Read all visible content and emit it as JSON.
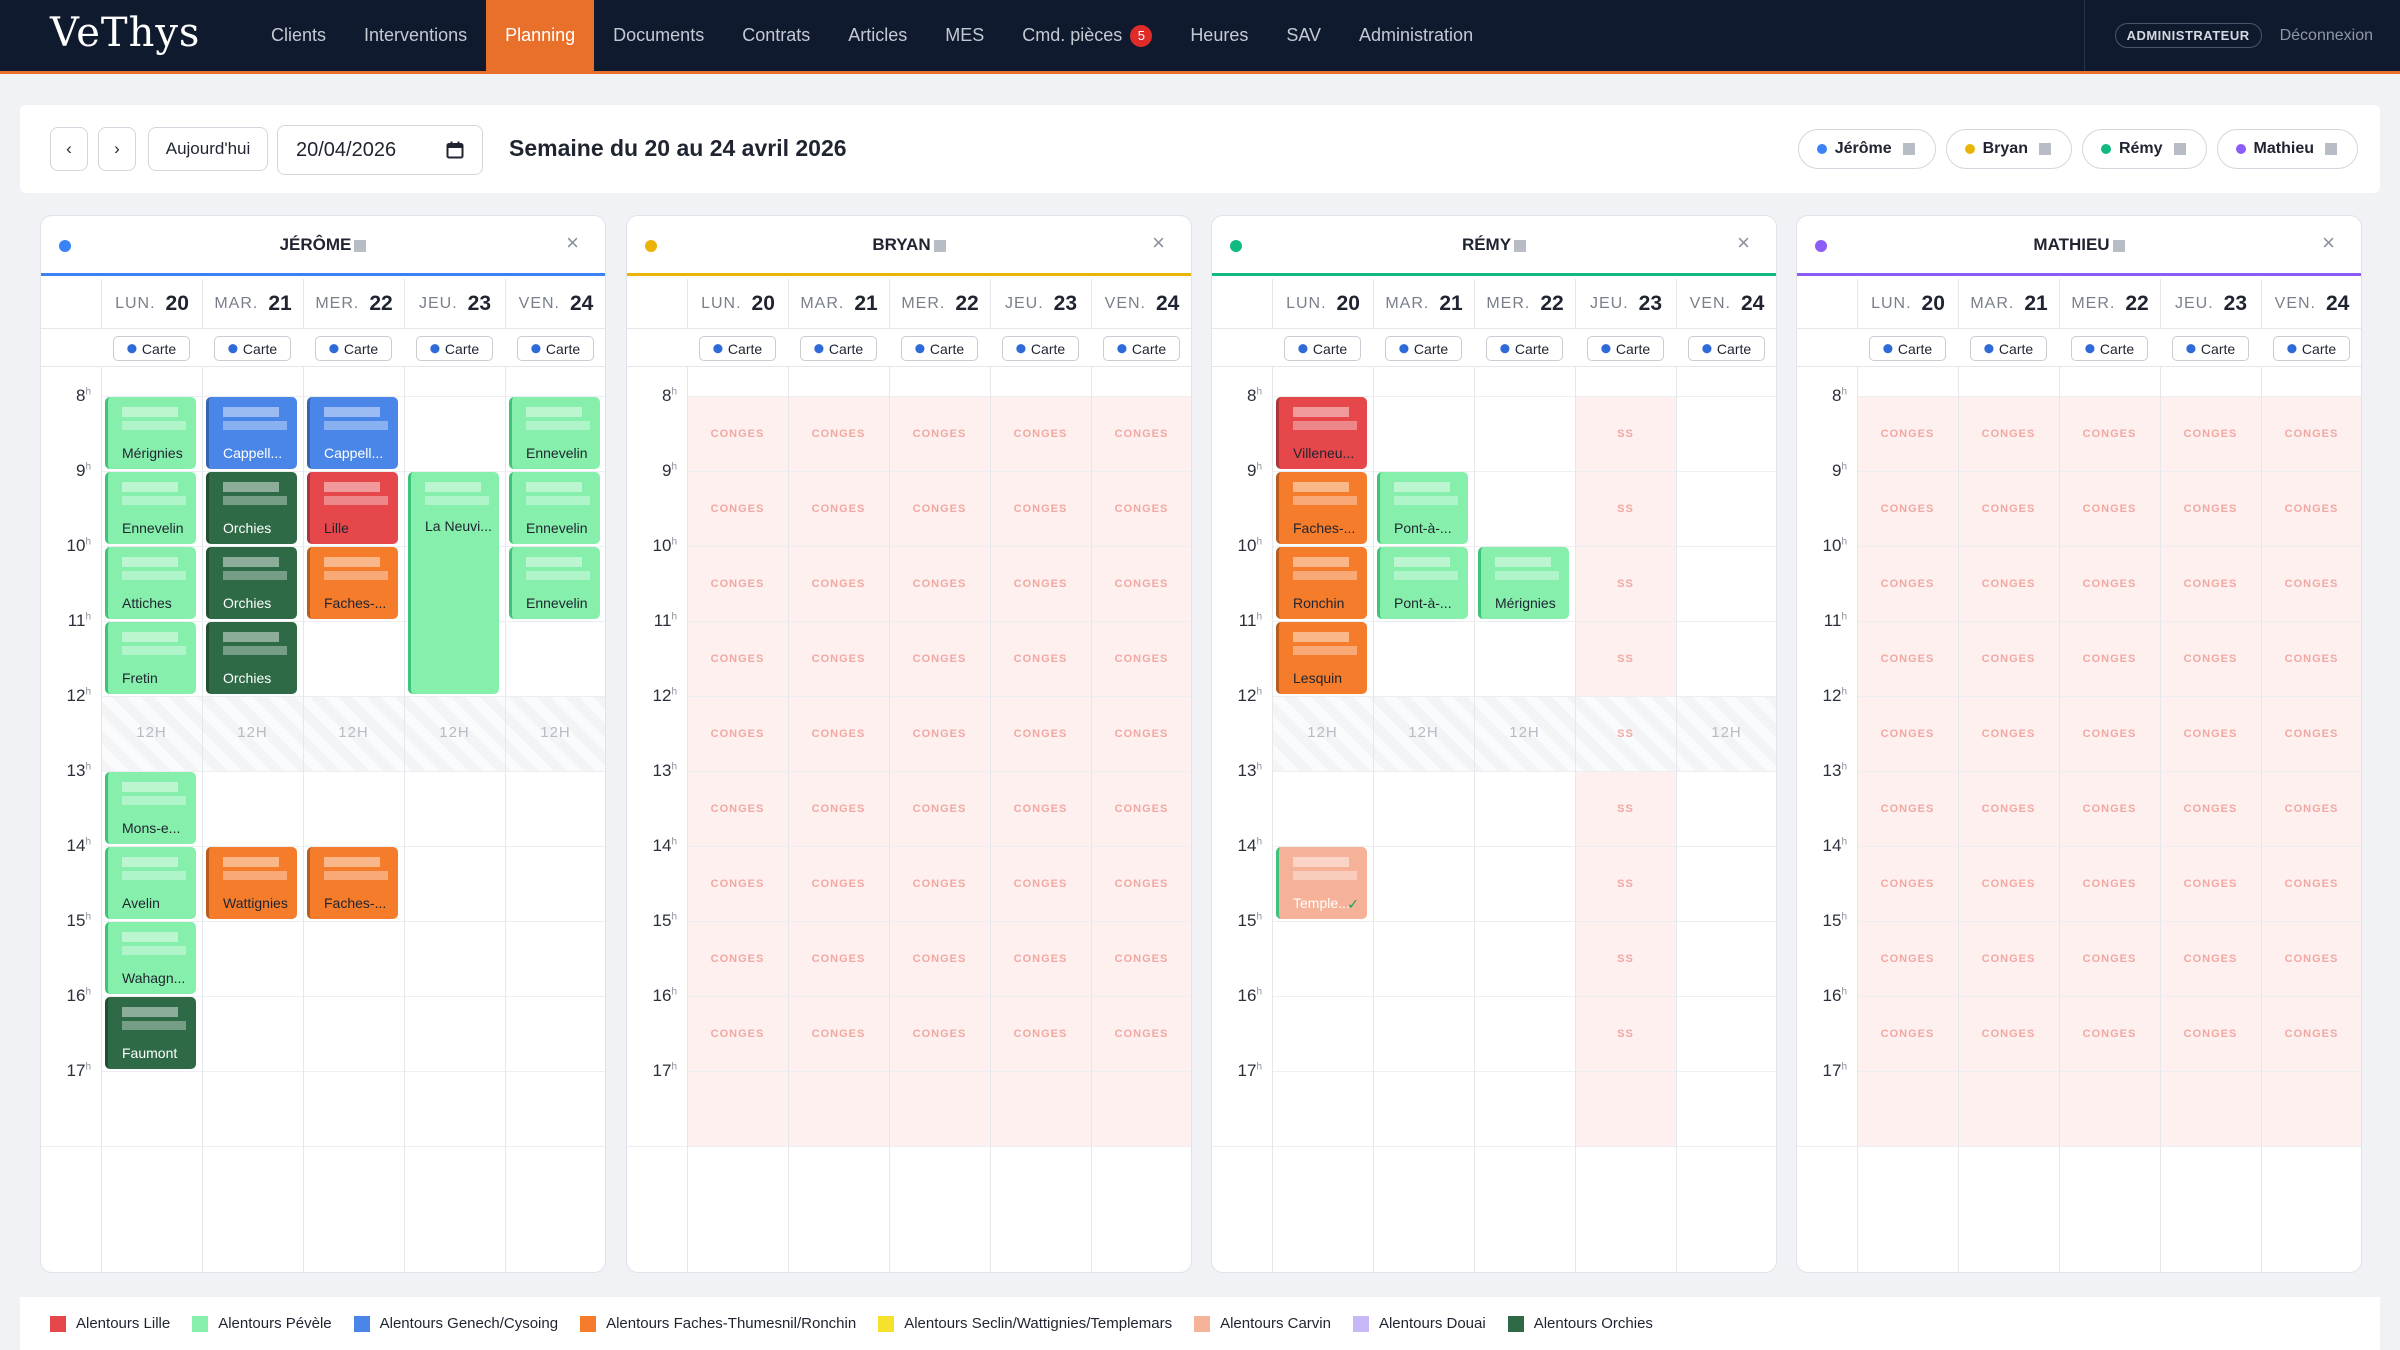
{
  "app": {
    "logo": "VeThys"
  },
  "nav": {
    "items": [
      "Clients",
      "Interventions",
      "Planning",
      "Documents",
      "Contrats",
      "Articles",
      "MES",
      "Cmd. pièces",
      "Heures",
      "SAV",
      "Administration"
    ],
    "active": "Planning",
    "badge": {
      "item": "Cmd. pièces",
      "count": "5"
    },
    "role": "ADMINISTRATEUR",
    "logout": "Déconnexion"
  },
  "toolbar": {
    "prev": "‹",
    "next": "›",
    "today": "Aujourd'hui",
    "date": "20/04/2026",
    "week_title": "Semaine du 20 au 24 avril 2026",
    "filters": [
      {
        "name": "Jérôme",
        "color": "#3b82f6"
      },
      {
        "name": "Bryan",
        "color": "#eab308"
      },
      {
        "name": "Rémy",
        "color": "#10b981"
      },
      {
        "name": "Mathieu",
        "color": "#8b5cf6"
      }
    ]
  },
  "days": [
    {
      "abbr": "LUN.",
      "num": "20"
    },
    {
      "abbr": "MAR.",
      "num": "21"
    },
    {
      "abbr": "MER.",
      "num": "22"
    },
    {
      "abbr": "JEU.",
      "num": "23"
    },
    {
      "abbr": "VEN.",
      "num": "24"
    }
  ],
  "carte_label": "Carte",
  "hours": [
    "8",
    "9",
    "10",
    "11",
    "12",
    "13",
    "14",
    "15",
    "16",
    "17"
  ],
  "lunch_label": "12H",
  "conges_label": "CONGES",
  "ss_label": "SS",
  "category_colors": {
    "lille": "#e5474b",
    "pevele": "#86efac",
    "genech": "#4a86e8",
    "faches": "#f57c2b",
    "seclin": "#f5e12b",
    "carvin": "#f6b199",
    "douai": "#c8b8f7",
    "orchies": "#2d6a45"
  },
  "technicians": [
    {
      "name": "JÉRÔME",
      "color": "#3b82f6",
      "lunch_days": [
        0,
        1,
        2,
        3,
        4
      ],
      "conges_days": [],
      "ss_days": [],
      "events": [
        {
          "day": 0,
          "start": 8,
          "end": 9,
          "cat": "pevele",
          "label": "Mérignies"
        },
        {
          "day": 0,
          "start": 9,
          "end": 10,
          "cat": "pevele",
          "label": "Ennevelin"
        },
        {
          "day": 0,
          "start": 10,
          "end": 11,
          "cat": "pevele",
          "label": "Attiches"
        },
        {
          "day": 0,
          "start": 11,
          "end": 12,
          "cat": "pevele",
          "label": "Fretin"
        },
        {
          "day": 0,
          "start": 13,
          "end": 14,
          "cat": "pevele",
          "label": "Mons-e..."
        },
        {
          "day": 0,
          "start": 14,
          "end": 15,
          "cat": "pevele",
          "label": "Avelin"
        },
        {
          "day": 0,
          "start": 15,
          "end": 16,
          "cat": "pevele",
          "label": "Wahagn..."
        },
        {
          "day": 0,
          "start": 16,
          "end": 17,
          "cat": "orchies",
          "label": "Faumont"
        },
        {
          "day": 1,
          "start": 8,
          "end": 9,
          "cat": "genech",
          "label": "Cappell..."
        },
        {
          "day": 1,
          "start": 9,
          "end": 10,
          "cat": "orchies",
          "label": "Orchies"
        },
        {
          "day": 1,
          "start": 10,
          "end": 11,
          "cat": "orchies",
          "label": "Orchies"
        },
        {
          "day": 1,
          "start": 11,
          "end": 12,
          "cat": "orchies",
          "label": "Orchies"
        },
        {
          "day": 1,
          "start": 14,
          "end": 15,
          "cat": "faches",
          "label": "Wattignies"
        },
        {
          "day": 2,
          "start": 8,
          "end": 9,
          "cat": "genech",
          "label": "Cappell..."
        },
        {
          "day": 2,
          "start": 9,
          "end": 10,
          "cat": "lille",
          "label": "Lille"
        },
        {
          "day": 2,
          "start": 10,
          "end": 11,
          "cat": "faches",
          "label": "Faches-..."
        },
        {
          "day": 2,
          "start": 14,
          "end": 15,
          "cat": "faches",
          "label": "Faches-..."
        },
        {
          "day": 3,
          "start": 9,
          "end": 12,
          "cat": "pevele",
          "label": "La Neuvi...",
          "top": true
        },
        {
          "day": 4,
          "start": 8,
          "end": 9,
          "cat": "pevele",
          "label": "Ennevelin"
        },
        {
          "day": 4,
          "start": 9,
          "end": 10,
          "cat": "pevele",
          "label": "Ennevelin"
        },
        {
          "day": 4,
          "start": 10,
          "end": 11,
          "cat": "pevele",
          "label": "Ennevelin"
        }
      ]
    },
    {
      "name": "BRYAN",
      "color": "#eab308",
      "lunch_days": [],
      "conges_days": [
        0,
        1,
        2,
        3,
        4
      ],
      "ss_days": [],
      "events": []
    },
    {
      "name": "RÉMY",
      "color": "#10b981",
      "lunch_days": [
        0,
        1,
        2,
        4
      ],
      "conges_days": [],
      "ss_days": [
        3
      ],
      "events": [
        {
          "day": 0,
          "start": 8,
          "end": 9,
          "cat": "lille",
          "label": "Villeneu..."
        },
        {
          "day": 0,
          "start": 9,
          "end": 10,
          "cat": "faches",
          "label": "Faches-..."
        },
        {
          "day": 0,
          "start": 10,
          "end": 11,
          "cat": "faches",
          "label": "Ronchin"
        },
        {
          "day": 0,
          "start": 11,
          "end": 12,
          "cat": "faches",
          "label": "Lesquin"
        },
        {
          "day": 0,
          "start": 14,
          "end": 15,
          "cat": "carvin",
          "label": "Temple...",
          "check": true
        },
        {
          "day": 1,
          "start": 9,
          "end": 10,
          "cat": "pevele",
          "label": "Pont-à-..."
        },
        {
          "day": 1,
          "start": 10,
          "end": 11,
          "cat": "pevele",
          "label": "Pont-à-..."
        },
        {
          "day": 2,
          "start": 10,
          "end": 11,
          "cat": "pevele",
          "label": "Mérignies"
        }
      ]
    },
    {
      "name": "MATHIEU",
      "color": "#8b5cf6",
      "lunch_days": [],
      "conges_days": [
        0,
        1,
        2,
        3,
        4
      ],
      "ss_days": [],
      "events": []
    }
  ],
  "legend": [
    {
      "label": "Alentours Lille",
      "color": "#e5474b"
    },
    {
      "label": "Alentours Pévèle",
      "color": "#86efac"
    },
    {
      "label": "Alentours Genech/Cysoing",
      "color": "#4a86e8"
    },
    {
      "label": "Alentours Faches-Thumesnil/Ronchin",
      "color": "#f57c2b"
    },
    {
      "label": "Alentours Seclin/Wattignies/Templemars",
      "color": "#f5e12b"
    },
    {
      "label": "Alentours Carvin",
      "color": "#f6b199"
    },
    {
      "label": "Alentours Douai",
      "color": "#c8b8f7"
    },
    {
      "label": "Alentours Orchies",
      "color": "#2d6a45"
    }
  ]
}
